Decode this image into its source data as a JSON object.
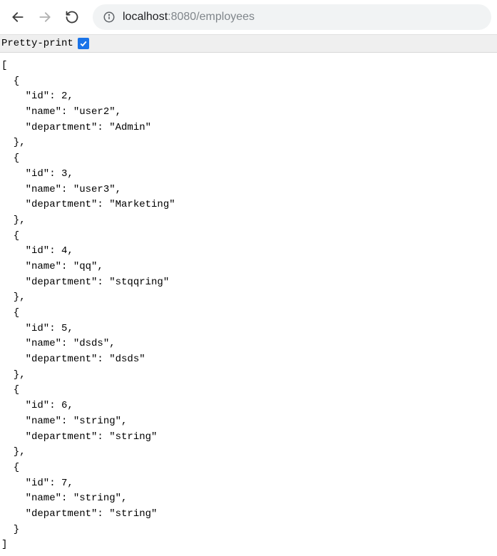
{
  "toolbar": {
    "url_host": "localhost",
    "url_port_path": ":8080/employees"
  },
  "pretty": {
    "label": "Pretty-print",
    "checked": true
  },
  "employees": [
    {
      "id": 2,
      "name": "user2",
      "department": "Admin"
    },
    {
      "id": 3,
      "name": "user3",
      "department": "Marketing"
    },
    {
      "id": 4,
      "name": "qq",
      "department": "stqqring"
    },
    {
      "id": 5,
      "name": "dsds",
      "department": "dsds"
    },
    {
      "id": 6,
      "name": "string",
      "department": "string"
    },
    {
      "id": 7,
      "name": "string",
      "department": "string"
    }
  ]
}
